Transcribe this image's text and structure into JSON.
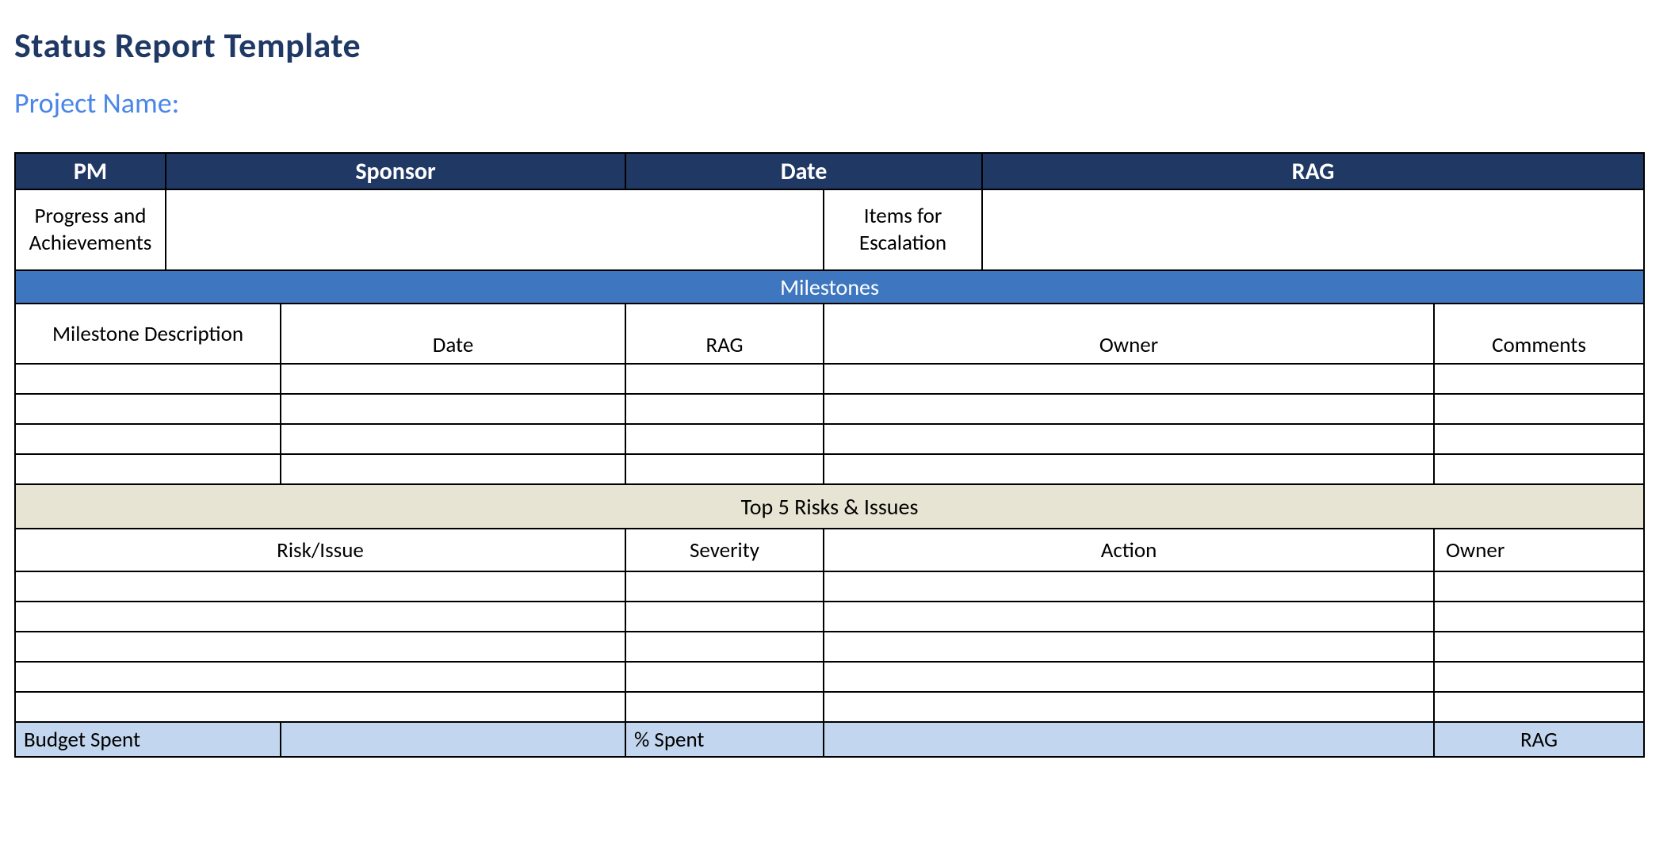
{
  "title": "Status Report Template",
  "project_name_label": "Project Name:",
  "top_headers": {
    "pm": "PM",
    "sponsor": "Sponsor",
    "date": "Date",
    "rag": "RAG"
  },
  "row_labels": {
    "progress": "Progress and Achievements",
    "escalation": "Items for Escalation"
  },
  "milestones": {
    "band": "Milestones",
    "columns": {
      "description": "Milestone Description",
      "date": "Date",
      "rag": "RAG",
      "owner": "Owner",
      "comments": "Comments"
    }
  },
  "risks": {
    "band": "Top 5 Risks & Issues",
    "columns": {
      "risk_issue": "Risk/Issue",
      "severity": "Severity",
      "action": "Action",
      "owner": "Owner"
    }
  },
  "budget": {
    "budget_spent": "Budget Spent",
    "pct_spent": "% Spent",
    "rag": "RAG"
  }
}
